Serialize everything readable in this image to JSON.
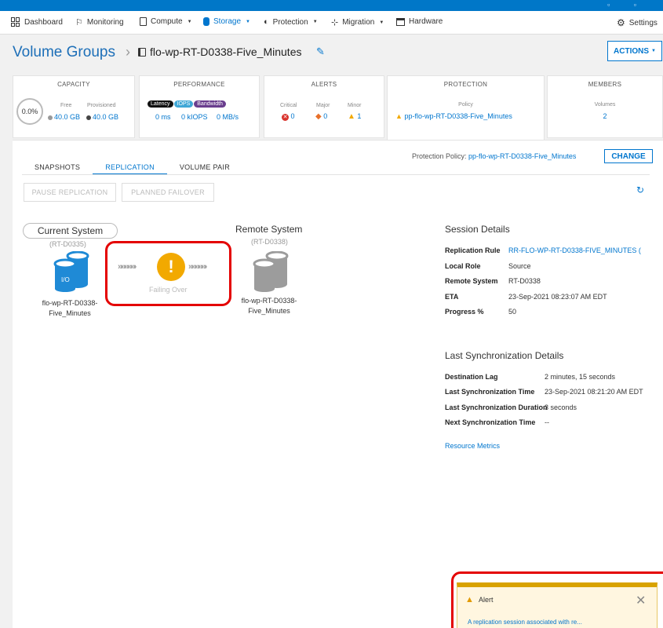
{
  "colors": {
    "brand": "#0076ce",
    "warning": "#f2a900",
    "highlight": "#e40000",
    "critical": "#d9322b",
    "major": "#e8702a"
  },
  "nav": {
    "items": [
      {
        "label": "Dashboard",
        "icon": "dashboard-icon"
      },
      {
        "label": "Monitoring",
        "icon": "flag-icon"
      },
      {
        "label": "Compute",
        "icon": "compute-icon"
      },
      {
        "label": "Storage",
        "icon": "storage-icon"
      },
      {
        "label": "Protection",
        "icon": "shield-icon"
      },
      {
        "label": "Migration",
        "icon": "migration-icon"
      },
      {
        "label": "Hardware",
        "icon": "hardware-icon"
      }
    ],
    "settings": "Settings"
  },
  "header": {
    "title": "Volume Groups",
    "volume_group": "flo-wp-RT-D0338-Five_Minutes",
    "actions": "ACTIONS"
  },
  "cards": {
    "capacity": {
      "title": "CAPACITY",
      "percent": "0.0%",
      "free_label": "Free",
      "provisioned_label": "Provisioned",
      "free": "40.0 GB",
      "provisioned": "40.0 GB"
    },
    "performance": {
      "title": "PERFORMANCE",
      "pills": [
        "Latency",
        "IOPS",
        "Bandwidth"
      ],
      "latency": "0 ms",
      "iops": "0 kIOPS",
      "bandwidth": "0 MB/s"
    },
    "alerts": {
      "title": "ALERTS",
      "critical_label": "Critical",
      "major_label": "Major",
      "minor_label": "Minor",
      "critical": "0",
      "major": "0",
      "minor": "1"
    },
    "protection": {
      "title": "PROTECTION",
      "policy_label": "Policy",
      "policy": "pp-flo-wp-RT-D0338-Five_Minutes"
    },
    "members": {
      "title": "MEMBERS",
      "volumes_label": "Volumes",
      "volumes": "2"
    }
  },
  "tabs": [
    "SNAPSHOTS",
    "REPLICATION",
    "VOLUME PAIR"
  ],
  "protection_policy": {
    "label": "Protection Policy:",
    "value": "pp-flo-wp-RT-D0338-Five_Minutes",
    "change": "CHANGE"
  },
  "buttons": {
    "pause": "PAUSE REPLICATION",
    "failover": "PLANNED FAILOVER"
  },
  "current_system": {
    "title": "Current System",
    "id": "(RT-D0335)",
    "io_label": "I/O",
    "volume_line1": "flo-wp-RT-D0338-",
    "volume_line2": "Five_Minutes"
  },
  "remote_system": {
    "title": "Remote System",
    "id": "(RT-D0338)",
    "volume_line1": "flo-wp-RT-D0338-",
    "volume_line2": "Five_Minutes"
  },
  "status": {
    "text": "Failing Over",
    "symbol": "!"
  },
  "session": {
    "title": "Session Details",
    "rows": [
      {
        "label": "Replication Rule",
        "value": "RR-FLO-WP-RT-D0338-FIVE_MINUTES ("
      },
      {
        "label": "Local Role",
        "value": "Source"
      },
      {
        "label": "Remote System",
        "value": "RT-D0338"
      },
      {
        "label": "ETA",
        "value": "23-Sep-2021 08:23:07 AM EDT"
      },
      {
        "label": "Progress %",
        "value": "50"
      }
    ]
  },
  "sync": {
    "title": "Last Synchronization Details",
    "rows": [
      {
        "label": "Destination Lag",
        "value": "2 minutes, 15 seconds"
      },
      {
        "label": "Last Synchronization Time",
        "value": "23-Sep-2021 08:21:20 AM EDT"
      },
      {
        "label": "Last Synchronization Duration",
        "value": "3 seconds"
      },
      {
        "label": "Next Synchronization Time",
        "value": "--"
      }
    ],
    "metrics_link": "Resource Metrics"
  },
  "alert": {
    "title": "Alert",
    "message": "A replication session associated with re..."
  }
}
